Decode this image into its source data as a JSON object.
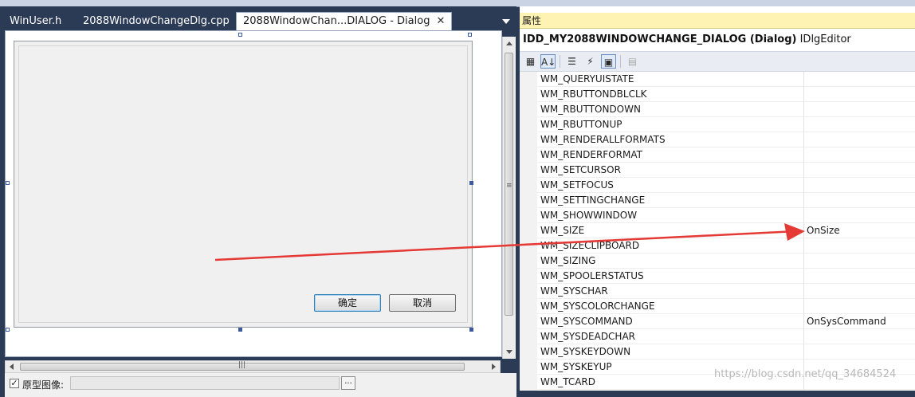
{
  "tabs": [
    {
      "label": "WinUser.h"
    },
    {
      "label": "2088WindowChangeDlg.cpp"
    },
    {
      "label": "2088WindowChan...DIALOG - Dialog",
      "close": "✕"
    }
  ],
  "dialog": {
    "ok_label": "确定",
    "cancel_label": "取消"
  },
  "bottom": {
    "prototype_checked": "✓",
    "prototype_label": "原型图像:",
    "browse_label": "..."
  },
  "properties": {
    "title": "属性",
    "object_name": "IDD_MY2088WINDOWCHANGE_DIALOG (Dialog)",
    "object_type": "IDlgEditor",
    "toolbar": [
      {
        "icon": "categorized-icon",
        "glyph": "▦"
      },
      {
        "icon": "alphabetical-icon",
        "glyph": "A↓"
      },
      {
        "icon": "properties-icon",
        "glyph": "☰"
      },
      {
        "icon": "events-icon",
        "glyph": "⚡"
      },
      {
        "icon": "messages-icon",
        "glyph": "▣"
      },
      {
        "icon": "overrides-icon",
        "glyph": "▤"
      }
    ],
    "rows": [
      {
        "name": "WM_QUERYUISTATE",
        "value": ""
      },
      {
        "name": "WM_RBUTTONDBLCLK",
        "value": ""
      },
      {
        "name": "WM_RBUTTONDOWN",
        "value": ""
      },
      {
        "name": "WM_RBUTTONUP",
        "value": ""
      },
      {
        "name": "WM_RENDERALLFORMATS",
        "value": ""
      },
      {
        "name": "WM_RENDERFORMAT",
        "value": ""
      },
      {
        "name": "WM_SETCURSOR",
        "value": ""
      },
      {
        "name": "WM_SETFOCUS",
        "value": ""
      },
      {
        "name": "WM_SETTINGCHANGE",
        "value": ""
      },
      {
        "name": "WM_SHOWWINDOW",
        "value": ""
      },
      {
        "name": "WM_SIZE",
        "value": "OnSize"
      },
      {
        "name": "WM_SIZECLIPBOARD",
        "value": ""
      },
      {
        "name": "WM_SIZING",
        "value": ""
      },
      {
        "name": "WM_SPOOLERSTATUS",
        "value": ""
      },
      {
        "name": "WM_SYSCHAR",
        "value": ""
      },
      {
        "name": "WM_SYSCOLORCHANGE",
        "value": ""
      },
      {
        "name": "WM_SYSCOMMAND",
        "value": "OnSysCommand"
      },
      {
        "name": "WM_SYSDEADCHAR",
        "value": ""
      },
      {
        "name": "WM_SYSKEYDOWN",
        "value": ""
      },
      {
        "name": "WM_SYSKEYUP",
        "value": ""
      },
      {
        "name": "WM_TCARD",
        "value": ""
      }
    ]
  },
  "watermark": "https://blog.csdn.net/qq_34684524",
  "colors": {
    "accent_arrow": "#e53935",
    "title_bg": "#fff3b3",
    "chrome_bg": "#2b3a55"
  }
}
